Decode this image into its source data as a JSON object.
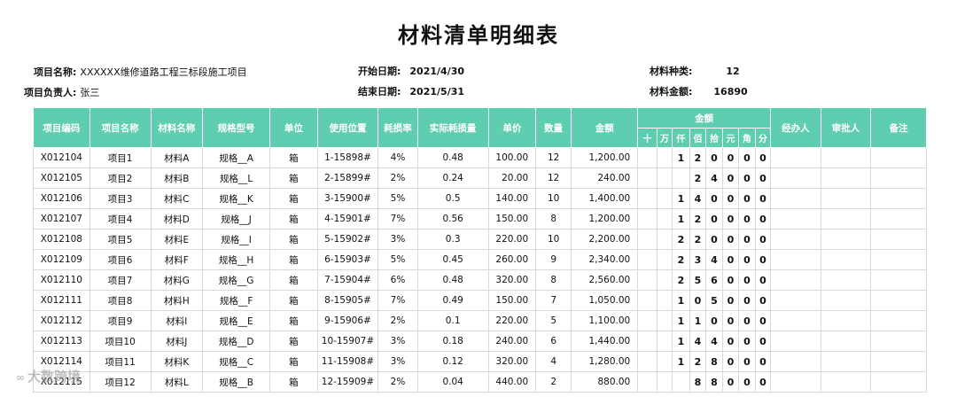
{
  "title": "材料清单明细表",
  "info": {
    "project_name_label": "项目名称:",
    "project_name": "XXXXXX维修道路工程三标段施工项目",
    "manager_label": "项目负责人:",
    "manager": "张三",
    "start_label": "开始日期:",
    "start_date": "2021/4/30",
    "end_label": "结束日期:",
    "end_date": "2021/5/31",
    "types_label": "材料种类:",
    "types": "12",
    "amount_label": "材料金额:",
    "amount": "16890"
  },
  "headers": {
    "code": "项目编码",
    "name": "项目名称",
    "material": "材料名称",
    "spec": "规格型号",
    "unit": "单位",
    "location": "使用位置",
    "loss_rate": "耗损率",
    "actual_loss": "实际耗损量",
    "price": "单价",
    "qty": "数量",
    "amount": "金额",
    "amount_group": "金额",
    "digits": [
      "十",
      "万",
      "仟",
      "佰",
      "拾",
      "元",
      "角",
      "分"
    ],
    "handler": "经办人",
    "approver": "审批人",
    "remark": "备注"
  },
  "rows": [
    {
      "code": "X012104",
      "name": "项目1",
      "material": "材料A",
      "spec": "规格__A",
      "unit": "箱",
      "location": "1-15898#",
      "loss_rate": "4%",
      "actual_loss": "0.48",
      "price": "100.00",
      "qty": "12",
      "amount": "1,200.00",
      "digits": [
        "",
        "",
        "1",
        "2",
        "0",
        "0",
        "0",
        "0"
      ]
    },
    {
      "code": "X012105",
      "name": "项目2",
      "material": "材料B",
      "spec": "规格__L",
      "unit": "箱",
      "location": "2-15899#",
      "loss_rate": "2%",
      "actual_loss": "0.24",
      "price": "20.00",
      "qty": "12",
      "amount": "240.00",
      "digits": [
        "",
        "",
        "",
        "2",
        "4",
        "0",
        "0",
        "0"
      ]
    },
    {
      "code": "X012106",
      "name": "项目3",
      "material": "材料C",
      "spec": "规格__K",
      "unit": "箱",
      "location": "3-15900#",
      "loss_rate": "5%",
      "actual_loss": "0.5",
      "price": "140.00",
      "qty": "10",
      "amount": "1,400.00",
      "digits": [
        "",
        "",
        "1",
        "4",
        "0",
        "0",
        "0",
        "0"
      ]
    },
    {
      "code": "X012107",
      "name": "项目4",
      "material": "材料D",
      "spec": "规格__J",
      "unit": "箱",
      "location": "4-15901#",
      "loss_rate": "7%",
      "actual_loss": "0.56",
      "price": "150.00",
      "qty": "8",
      "amount": "1,200.00",
      "digits": [
        "",
        "",
        "1",
        "2",
        "0",
        "0",
        "0",
        "0"
      ]
    },
    {
      "code": "X012108",
      "name": "项目5",
      "material": "材料E",
      "spec": "规格__I",
      "unit": "箱",
      "location": "5-15902#",
      "loss_rate": "3%",
      "actual_loss": "0.3",
      "price": "220.00",
      "qty": "10",
      "amount": "2,200.00",
      "digits": [
        "",
        "",
        "2",
        "2",
        "0",
        "0",
        "0",
        "0"
      ]
    },
    {
      "code": "X012109",
      "name": "项目6",
      "material": "材料F",
      "spec": "规格__H",
      "unit": "箱",
      "location": "6-15903#",
      "loss_rate": "5%",
      "actual_loss": "0.45",
      "price": "260.00",
      "qty": "9",
      "amount": "2,340.00",
      "digits": [
        "",
        "",
        "2",
        "3",
        "4",
        "0",
        "0",
        "0"
      ]
    },
    {
      "code": "X012110",
      "name": "项目7",
      "material": "材料G",
      "spec": "规格__G",
      "unit": "箱",
      "location": "7-15904#",
      "loss_rate": "6%",
      "actual_loss": "0.48",
      "price": "320.00",
      "qty": "8",
      "amount": "2,560.00",
      "digits": [
        "",
        "",
        "2",
        "5",
        "6",
        "0",
        "0",
        "0"
      ]
    },
    {
      "code": "X012111",
      "name": "项目8",
      "material": "材料H",
      "spec": "规格__F",
      "unit": "箱",
      "location": "8-15905#",
      "loss_rate": "7%",
      "actual_loss": "0.49",
      "price": "150.00",
      "qty": "7",
      "amount": "1,050.00",
      "digits": [
        "",
        "",
        "1",
        "0",
        "5",
        "0",
        "0",
        "0"
      ]
    },
    {
      "code": "X012112",
      "name": "项目9",
      "material": "材料I",
      "spec": "规格__E",
      "unit": "箱",
      "location": "9-15906#",
      "loss_rate": "2%",
      "actual_loss": "0.1",
      "price": "220.00",
      "qty": "5",
      "amount": "1,100.00",
      "digits": [
        "",
        "",
        "1",
        "1",
        "0",
        "0",
        "0",
        "0"
      ]
    },
    {
      "code": "X012113",
      "name": "项目10",
      "material": "材料J",
      "spec": "规格__D",
      "unit": "箱",
      "location": "10-15907#",
      "loss_rate": "3%",
      "actual_loss": "0.18",
      "price": "240.00",
      "qty": "6",
      "amount": "1,440.00",
      "digits": [
        "",
        "",
        "1",
        "4",
        "4",
        "0",
        "0",
        "0"
      ]
    },
    {
      "code": "X012114",
      "name": "项目11",
      "material": "材料K",
      "spec": "规格__C",
      "unit": "箱",
      "location": "11-15908#",
      "loss_rate": "3%",
      "actual_loss": "0.12",
      "price": "320.00",
      "qty": "4",
      "amount": "1,280.00",
      "digits": [
        "",
        "",
        "1",
        "2",
        "8",
        "0",
        "0",
        "0"
      ]
    },
    {
      "code": "X012115",
      "name": "项目12",
      "material": "材料L",
      "spec": "规格__B",
      "unit": "箱",
      "location": "12-15909#",
      "loss_rate": "2%",
      "actual_loss": "0.04",
      "price": "440.00",
      "qty": "2",
      "amount": "880.00",
      "digits": [
        "",
        "",
        "",
        "8",
        "8",
        "0",
        "0",
        "0"
      ]
    }
  ],
  "watermark": "大数跨境",
  "colors": {
    "header_bg": "#5ecdb0",
    "header_text": "#ffffff",
    "border": "#d9d9d9"
  }
}
